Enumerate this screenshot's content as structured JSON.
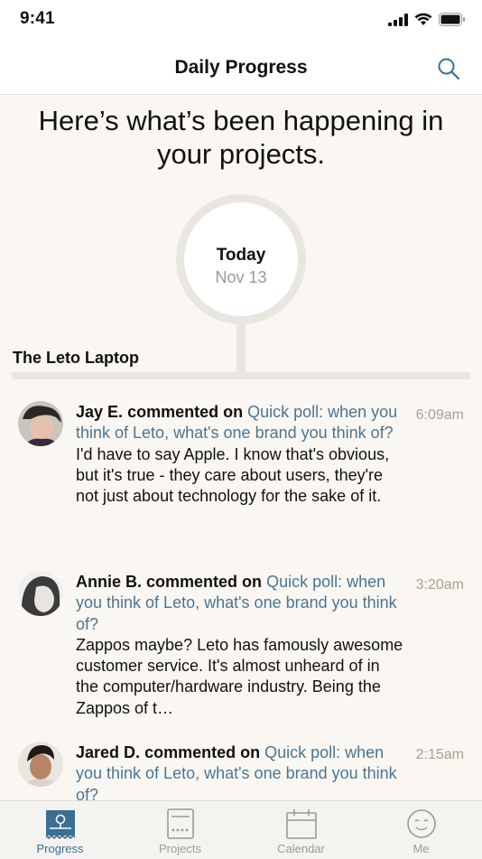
{
  "status_bar": {
    "time": "9:41"
  },
  "nav": {
    "title": "Daily Progress"
  },
  "headline": "Here’s what’s been happening in your projects.",
  "date_marker": {
    "today": "Today",
    "date": "Nov 13"
  },
  "project": {
    "name": "The Leto Laptop"
  },
  "feed": [
    {
      "author": "Jay E.",
      "verb": "commented on",
      "link": "Quick poll: when you think of Leto, what's one brand you think of?",
      "body": "I'd have to say Apple. I know that's obvious, but it's true - they care about users, they're not just about technology for the sake of it.",
      "time": "6:09am"
    },
    {
      "author": "Annie B.",
      "verb": "commented on",
      "link": "Quick poll: when you think of Leto, what's one brand you think of?",
      "body": "Zappos maybe? Leto has famously awesome customer service. It's almost unheard of in the computer/hardware industry. Being the Zappos of t…",
      "time": "3:20am"
    },
    {
      "author": "Jared D.",
      "verb": "commented on",
      "link": "Quick poll: when you think of Leto, what's one brand you think of?",
      "body": "",
      "time": "2:15am"
    }
  ],
  "tabs": [
    {
      "label": "Progress",
      "icon": "progress-icon",
      "active": true
    },
    {
      "label": "Projects",
      "icon": "projects-icon",
      "active": false
    },
    {
      "label": "Calendar",
      "icon": "calendar-icon",
      "active": false
    },
    {
      "label": "Me",
      "icon": "me-icon",
      "active": false
    }
  ],
  "colors": {
    "link": "#4a7595",
    "active_tab": "#3a6e93",
    "background": "#faf7f2",
    "timeline": "#e9e6e0"
  }
}
